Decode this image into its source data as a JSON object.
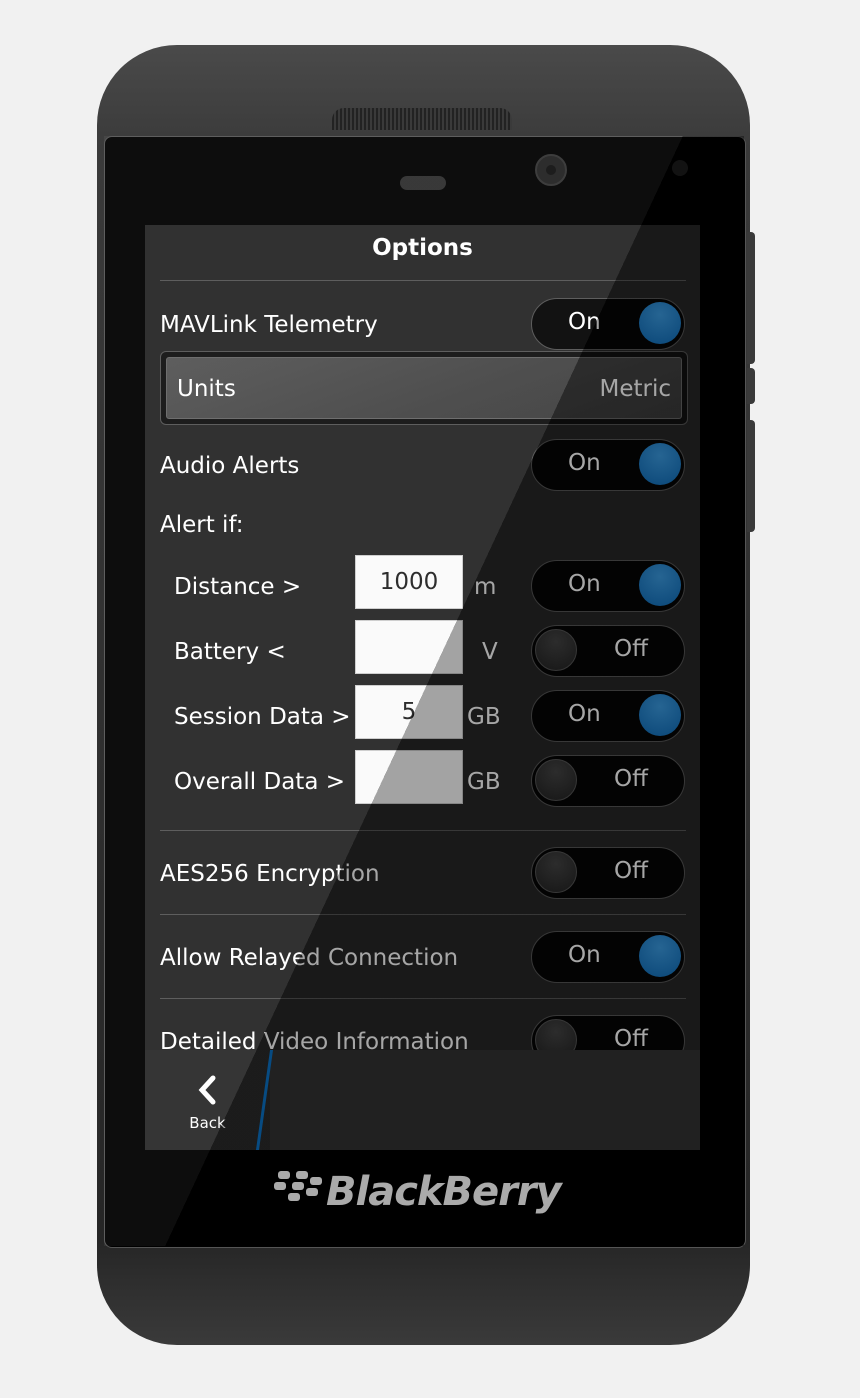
{
  "header": {
    "title": "Options"
  },
  "settings": {
    "mavlink": {
      "label": "MAVLink Telemetry",
      "state": "On"
    },
    "units": {
      "label": "Units",
      "value": "Metric"
    },
    "audio": {
      "label": "Audio Alerts",
      "state": "On"
    },
    "alert_if": "Alert if:",
    "alerts": [
      {
        "label": "Distance >",
        "value": "1000",
        "unit": "m",
        "state": "On"
      },
      {
        "label": "Battery <",
        "value": "",
        "unit": "V",
        "state": "Off"
      },
      {
        "label": "Session Data >",
        "value": "5",
        "unit": "GB",
        "state": "On"
      },
      {
        "label": "Overall Data >",
        "value": "",
        "unit": "GB",
        "state": "Off"
      }
    ],
    "aes": {
      "label": "AES256 Encryption",
      "state": "Off"
    },
    "relay": {
      "label": "Allow Relayed Connection",
      "state": "On"
    },
    "video": {
      "label": "Detailed Video Information",
      "state": "Off"
    }
  },
  "actionbar": {
    "back_label": "Back",
    "back_icon": "chevron-left-icon"
  },
  "brand": {
    "logo_text": "BlackBerry"
  },
  "colors": {
    "accent": "#0f6cb8",
    "background": "#262626"
  }
}
